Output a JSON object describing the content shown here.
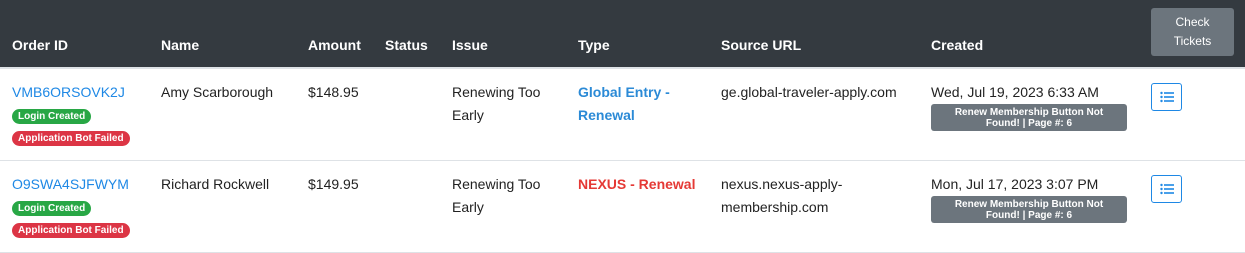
{
  "header": {
    "columns": [
      "Order ID",
      "Name",
      "Amount",
      "Status",
      "Issue",
      "Type",
      "Source URL",
      "Created"
    ],
    "check_button": "Check Tickets"
  },
  "rows": [
    {
      "order_id": "VMB6ORSOVK2J",
      "badges": [
        "Login Created",
        "Application Bot Failed"
      ],
      "name": "Amy Scarborough",
      "amount": "$148.95",
      "status": "",
      "issue_line1": "Renewing Too",
      "issue_line2": "Early",
      "type_line1": "Global Entry -",
      "type_line2": "Renewal",
      "type_color": "#2b8ad6",
      "source_line1": "ge.global-traveler-apply.com",
      "source_line2": "",
      "created": "Wed, Jul 19, 2023 6:33 AM",
      "note": "Renew Membership Button Not Found! | Page #: 6"
    },
    {
      "order_id": "O9SWA4SJFWYM",
      "badges": [
        "Login Created",
        "Application Bot Failed"
      ],
      "name": "Richard Rockwell",
      "amount": "$149.95",
      "status": "",
      "issue_line1": "Renewing Too",
      "issue_line2": "Early",
      "type_line1": "NEXUS - Renewal",
      "type_line2": "",
      "type_color": "#e53935",
      "source_line1": "nexus.nexus-apply-",
      "source_line2": "membership.com",
      "created": "Mon, Jul 17, 2023 3:07 PM",
      "note": "Renew Membership Button Not Found! | Page #: 6"
    }
  ],
  "icons": {
    "list_action": "list-icon"
  }
}
